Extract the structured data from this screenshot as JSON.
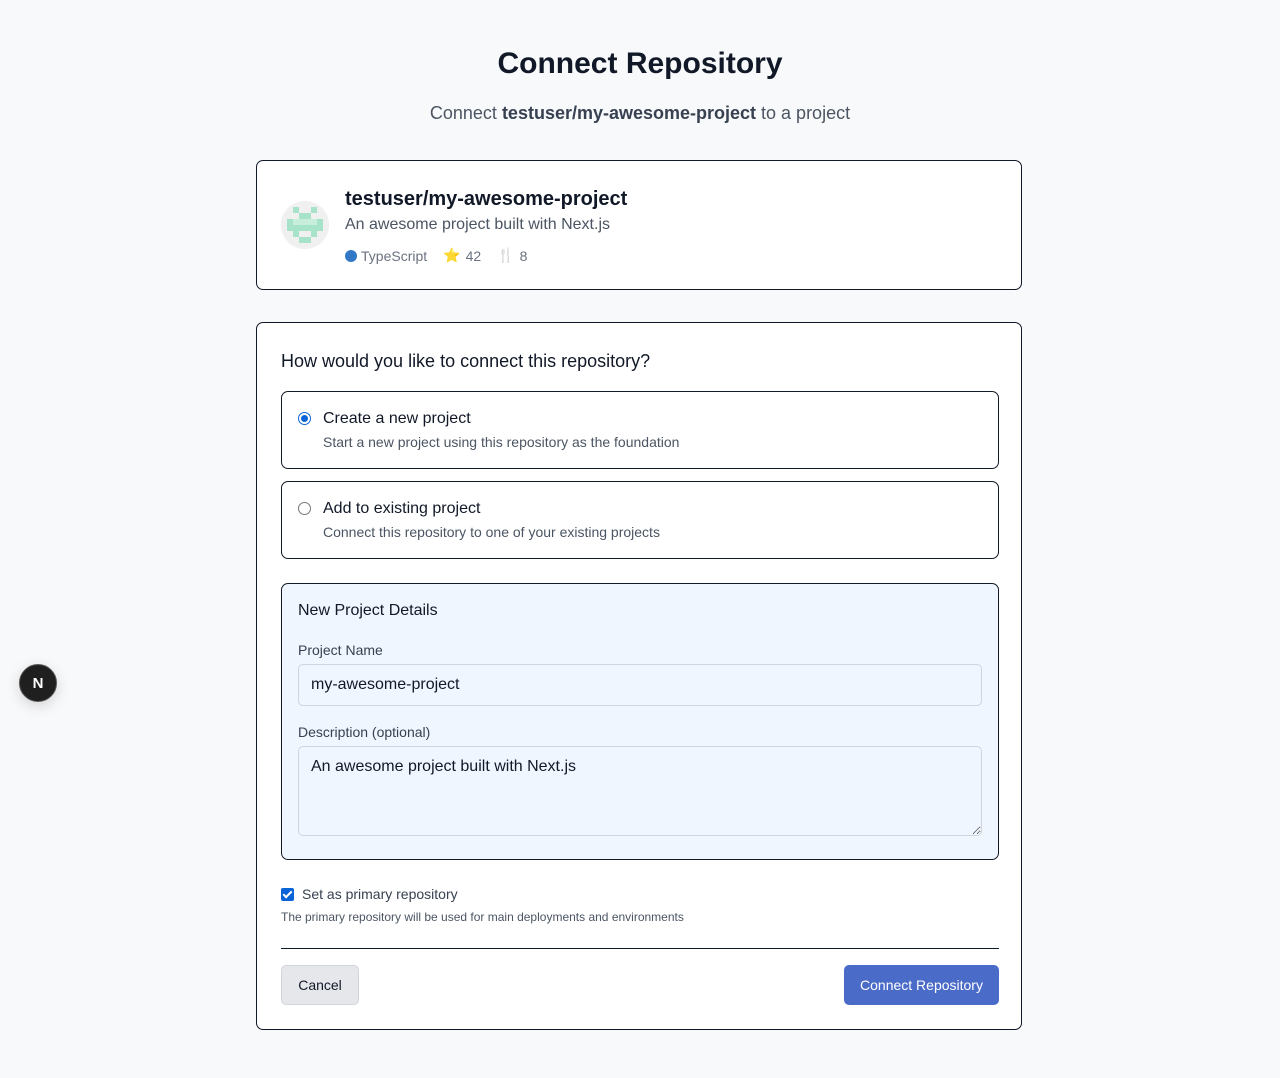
{
  "header": {
    "title": "Connect Repository",
    "subtitle_prefix": "Connect ",
    "subtitle_repo": "testuser/my-awesome-project",
    "subtitle_suffix": " to a project"
  },
  "repo": {
    "full_name": "testuser/my-awesome-project",
    "description": "An awesome project built with Next.js",
    "language": "TypeScript",
    "language_color": "#3178c6",
    "stars": "42",
    "forks": "8",
    "star_icon": "⭐",
    "fork_icon": "🍴"
  },
  "form": {
    "question": "How would you like to connect this repository?",
    "options": [
      {
        "title": "Create a new project",
        "description": "Start a new project using this repository as the foundation",
        "selected": true
      },
      {
        "title": "Add to existing project",
        "description": "Connect this repository to one of your existing projects",
        "selected": false
      }
    ],
    "details": {
      "title": "New Project Details",
      "name_label": "Project Name",
      "name_value": "my-awesome-project",
      "desc_label": "Description (optional)",
      "desc_value": "An awesome project built with Next.js"
    },
    "primary": {
      "label": "Set as primary repository",
      "help": "The primary repository will be used for main deployments and environments",
      "checked": true
    },
    "cancel_label": "Cancel",
    "connect_label": "Connect Repository"
  },
  "dev_badge": {
    "label": "N",
    "icon": "nextjs-icon"
  },
  "colors": {
    "accent": "#0b63d8",
    "primary_button": "#4a6cc8",
    "details_bg": "#eff6ff"
  }
}
